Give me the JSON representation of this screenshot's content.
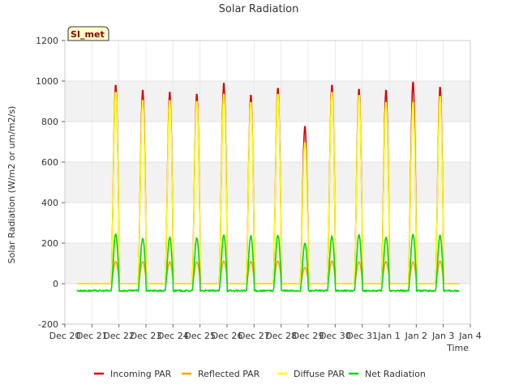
{
  "chart_data": {
    "type": "line",
    "title": "Solar Radiation",
    "xlabel": "Time",
    "ylabel": "Solar Radiation (W/m2 or um/m2/s)",
    "badge": "SI_met",
    "ylim": [
      -200,
      1200
    ],
    "yticks": [
      -200,
      0,
      200,
      400,
      600,
      800,
      1000,
      1200
    ],
    "xlim": [
      0,
      15
    ],
    "xticks": [
      {
        "x": 0,
        "label": "Dec 20"
      },
      {
        "x": 1,
        "label": "Dec 21"
      },
      {
        "x": 2,
        "label": "Dec 22"
      },
      {
        "x": 3,
        "label": "Dec 23"
      },
      {
        "x": 4,
        "label": "Dec 24"
      },
      {
        "x": 5,
        "label": "Dec 25"
      },
      {
        "x": 6,
        "label": "Dec 26"
      },
      {
        "x": 7,
        "label": "Dec 27"
      },
      {
        "x": 8,
        "label": "Dec 28"
      },
      {
        "x": 9,
        "label": "Dec 29"
      },
      {
        "x": 10,
        "label": "Dec 30"
      },
      {
        "x": 11,
        "label": "Dec 31"
      },
      {
        "x": 12,
        "label": "Jan 1"
      },
      {
        "x": 13,
        "label": "Jan 2"
      },
      {
        "x": 14,
        "label": "Jan 3"
      },
      {
        "x": 15,
        "label": "Jan 4"
      }
    ],
    "grid": true,
    "legend_position": "bottom",
    "days": [
      "Dec 21",
      "Dec 22",
      "Dec 23",
      "Dec 24",
      "Dec 25",
      "Dec 26",
      "Dec 27",
      "Dec 28",
      "Dec 29",
      "Dec 30",
      "Dec 31",
      "Jan 1",
      "Jan 2",
      "Jan 3"
    ],
    "series": [
      {
        "name": "Incoming PAR",
        "color": "#dd0000",
        "daily_peak": [
          985,
          960,
          950,
          940,
          995,
          935,
          970,
          780,
          985,
          965,
          960,
          1000,
          975,
          970
        ],
        "night_value": 0
      },
      {
        "name": "Reflected PAR",
        "color": "#ffa500",
        "daily_peak": [
          110,
          110,
          108,
          108,
          112,
          110,
          112,
          80,
          112,
          108,
          110,
          108,
          112,
          112
        ],
        "night_value": 0
      },
      {
        "name": "Diffuse PAR",
        "color": "#ffff00",
        "daily_peak": [
          950,
          910,
          910,
          905,
          940,
          900,
          940,
          700,
          950,
          935,
          900,
          900,
          930,
          910
        ],
        "night_value": 0
      },
      {
        "name": "Net Radiation",
        "color": "#00dd00",
        "daily_peak": [
          245,
          225,
          230,
          225,
          240,
          235,
          240,
          200,
          235,
          240,
          230,
          245,
          238,
          230
        ],
        "night_value": -35
      }
    ]
  }
}
